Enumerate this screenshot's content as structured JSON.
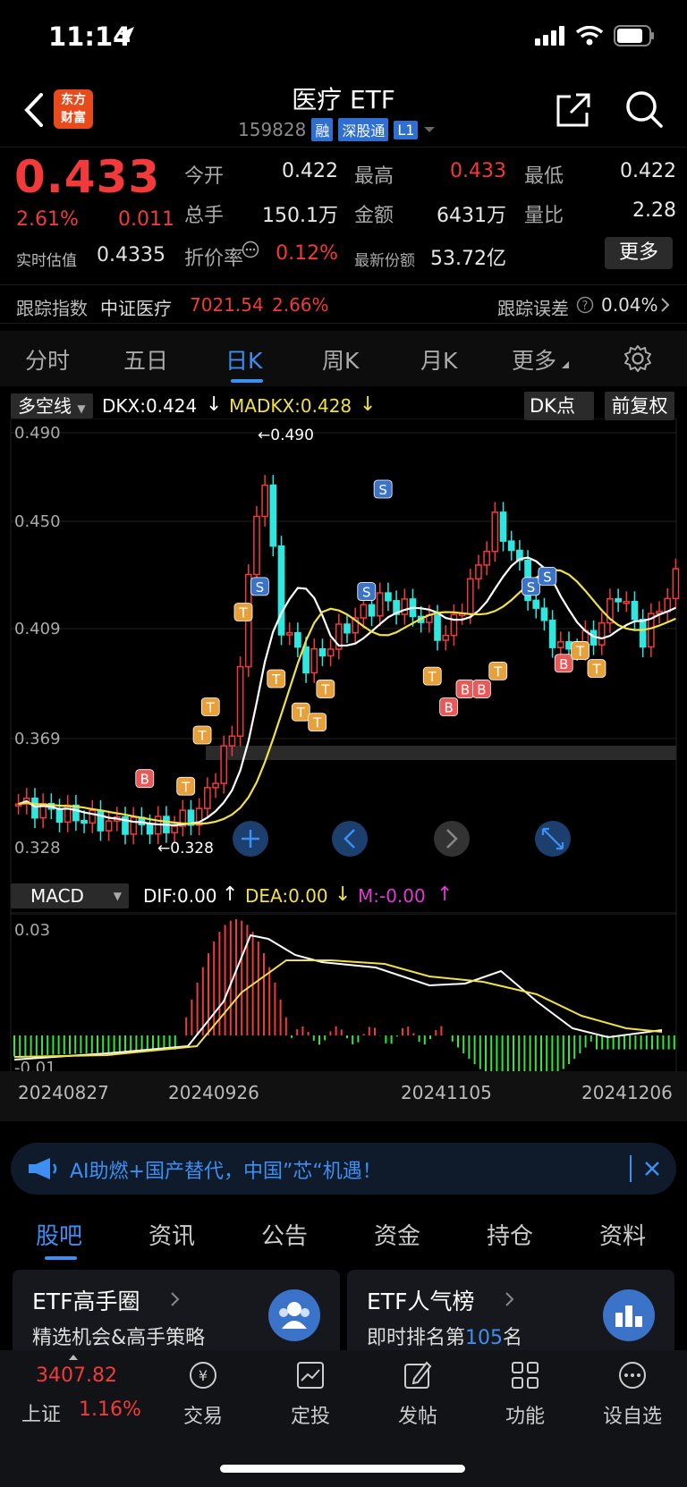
{
  "status": {
    "time": "11:14"
  },
  "nav": {
    "logo": "东方\n财富",
    "title": "医疗 ETF",
    "code": "159828",
    "tags": [
      "融",
      "深股通",
      "L1"
    ]
  },
  "quote": {
    "price": "0.433",
    "change_pct": "2.61%",
    "change_abs": "0.011",
    "est_label": "实时估值",
    "est_value": "0.4335",
    "open_label": "今开",
    "open": "0.422",
    "high_label": "最高",
    "high": "0.433",
    "low_label": "最低",
    "low": "0.422",
    "volume_label": "总手",
    "volume": "150.1万",
    "amount_label": "金额",
    "amount": "6431万",
    "ratio_label": "量比",
    "ratio": "2.28",
    "premium_label": "折价率",
    "premium": "0.12%",
    "shares_label": "最新份额",
    "shares": "53.72亿",
    "more": "更多"
  },
  "tracking": {
    "label": "跟踪指数",
    "index": "中证医疗",
    "value": "7021.54",
    "pct": "2.66%",
    "err_label": "跟踪误差",
    "err": "0.04%"
  },
  "period_tabs": [
    "分时",
    "五日",
    "日K",
    "周K",
    "月K",
    "更多"
  ],
  "chart": {
    "indicator": "多空线",
    "dkx": "DKX:0.424",
    "madkx": "MADKX:0.428",
    "dk_button": "DK点",
    "adjust_button": "前复权",
    "price_ticks": [
      "0.490",
      "0.450",
      "0.409",
      "0.369",
      "0.328"
    ],
    "max_label": "0.490",
    "min_label": "0.328",
    "macd_name": "MACD",
    "dif": "DIF:0.00",
    "dea": "DEA:0.00",
    "m": "M:-0.00",
    "macd_ticks": [
      "0.03",
      "-0.01"
    ],
    "dates": [
      "20240827",
      "20240926",
      "20241105",
      "20241206"
    ]
  },
  "chart_data": {
    "type": "candlestick",
    "ylim": [
      0.328,
      0.49
    ],
    "high": 0.49,
    "low": 0.328,
    "last_close": 0.433
  },
  "banner": {
    "text": "AI助燃+国产替代，中国”芯“机遇！"
  },
  "bottom_tabs": [
    "股吧",
    "资讯",
    "公告",
    "资金",
    "持仓",
    "资料"
  ],
  "cards": [
    {
      "title": "ETF高手圈",
      "sub": "精选机会&高手策略"
    },
    {
      "title": "ETF人气榜",
      "sub_prefix": "即时排名第",
      "rank": "105",
      "sub_suffix": "名"
    }
  ],
  "tabbar": {
    "index_value": "3407.82",
    "index_name": "上证",
    "index_pct": "1.16%",
    "items": [
      "交易",
      "定投",
      "发帖",
      "功能",
      "设自选"
    ]
  }
}
